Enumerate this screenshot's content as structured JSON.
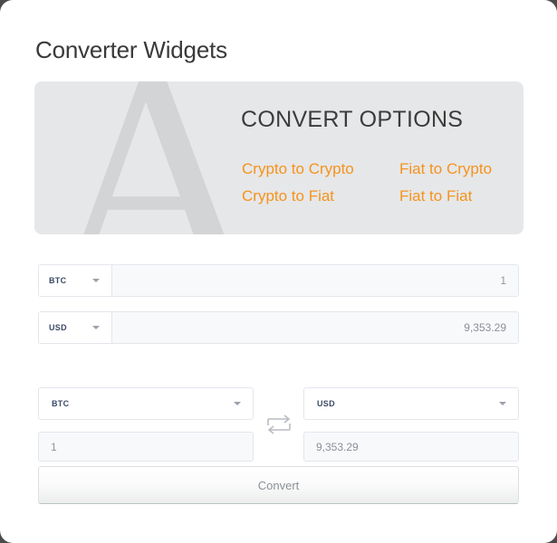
{
  "page": {
    "title": "Converter Widgets",
    "background_color": "#ffffff",
    "outer_background_color": "#4b4b4b",
    "accent_color": "#f5931d"
  },
  "options_card": {
    "watermark_letter": "A",
    "watermark_color": "#d2d4d5",
    "background_color": "#e6e7e8",
    "heading": "CONVERT OPTIONS",
    "links": [
      {
        "label": "Crypto to Crypto"
      },
      {
        "label": "Fiat to Crypto"
      },
      {
        "label": "Crypto to Fiat"
      },
      {
        "label": "Fiat to Fiat"
      }
    ]
  },
  "inline_converter": {
    "rows": [
      {
        "currency": "BTC",
        "value": "1",
        "placeholder": "1",
        "caret_icon": "chevron-down-icon"
      },
      {
        "currency": "USD",
        "value": "9,353.29",
        "placeholder": "9,353.29",
        "caret_icon": "chevron-down-icon"
      }
    ]
  },
  "stacked_converter": {
    "from": {
      "currency": "BTC",
      "value": "1",
      "placeholder": "1",
      "caret_icon": "chevron-down-icon"
    },
    "to": {
      "currency": "USD",
      "value": "9,353.29",
      "placeholder": "9,353.29",
      "caret_icon": "chevron-down-icon"
    },
    "swap_icon": "swap-arrows-icon",
    "convert_label": "Convert"
  }
}
